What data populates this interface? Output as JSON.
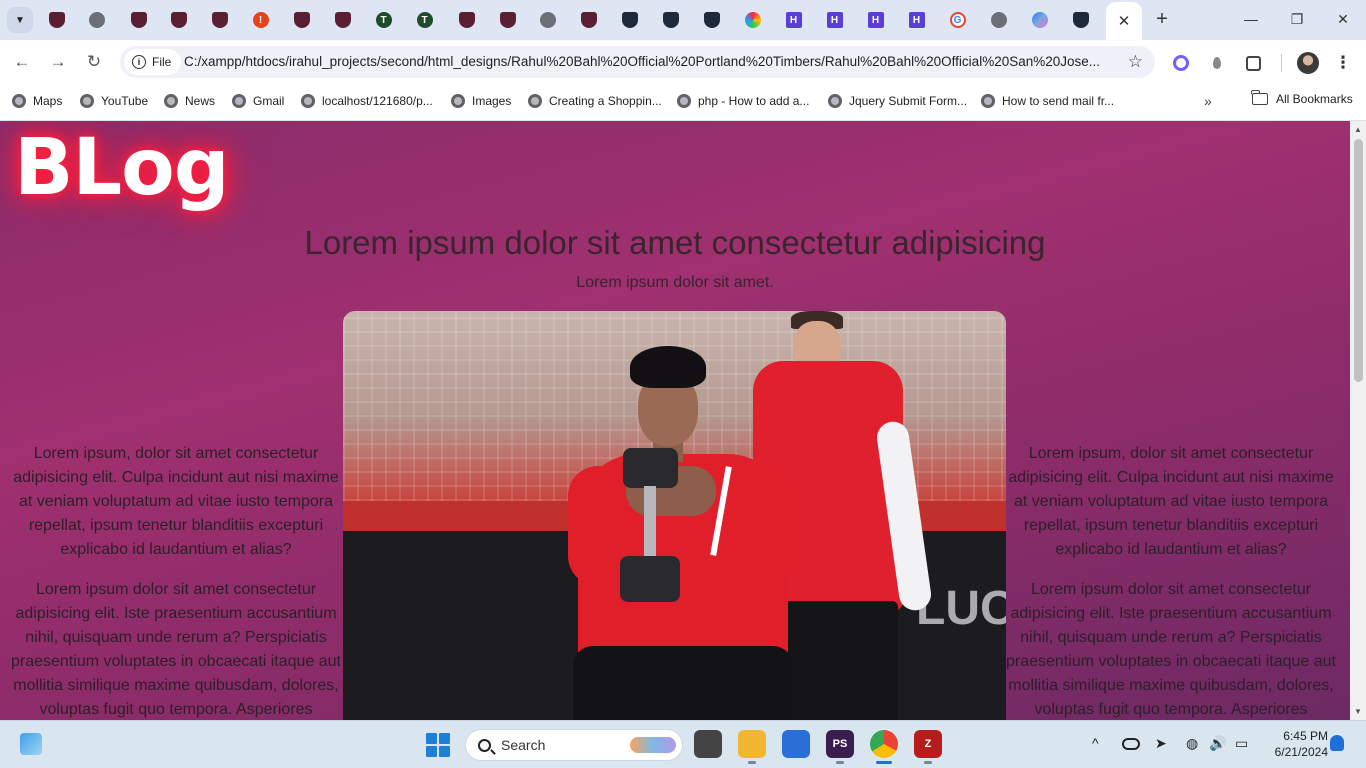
{
  "browser": {
    "tabs": [
      {
        "icon": "shield-crest-icon"
      },
      {
        "icon": "globe-icon"
      },
      {
        "icon": "shield-crest-icon"
      },
      {
        "icon": "shield-crest-icon"
      },
      {
        "icon": "shield-crest-icon"
      },
      {
        "icon": "alert-icon"
      },
      {
        "icon": "shield-crest-icon"
      },
      {
        "icon": "shield-crest-icon"
      },
      {
        "icon": "timbers-icon"
      },
      {
        "icon": "timbers-icon"
      },
      {
        "icon": "shield-crest-icon"
      },
      {
        "icon": "shield-crest-icon"
      },
      {
        "icon": "globe-icon"
      },
      {
        "icon": "shield-crest-icon"
      },
      {
        "icon": "sj-shield-icon"
      },
      {
        "icon": "sj-shield-icon"
      },
      {
        "icon": "sj-shield-icon"
      },
      {
        "icon": "ring-icon"
      },
      {
        "icon": "hh-icon"
      },
      {
        "icon": "hh-icon"
      },
      {
        "icon": "hh-icon"
      },
      {
        "icon": "hh-icon"
      },
      {
        "icon": "google-icon"
      },
      {
        "icon": "globe-icon"
      },
      {
        "icon": "copilot-icon"
      },
      {
        "icon": "sj-shield-icon"
      }
    ],
    "active_tab_close": "✕",
    "new_tab": "+",
    "window_controls": {
      "minimize": "—",
      "maximize": "❐",
      "close": "✕"
    },
    "toolbar": {
      "back": "←",
      "forward": "→",
      "reload": "↻",
      "site_chip": "File",
      "url": "C:/xampp/htdocs/irahul_projects/second/html_designs/Rahul%20Bahl%20Official%20Portland%20Timbers/Rahul%20Bahl%20Official%20San%20Jose...",
      "star": "☆",
      "menu": "⋮"
    },
    "bookmarks": [
      {
        "label": "Maps"
      },
      {
        "label": "YouTube"
      },
      {
        "label": "News"
      },
      {
        "label": "Gmail"
      },
      {
        "label": "localhost/121680/p..."
      },
      {
        "label": "Images"
      },
      {
        "label": "Creating a Shoppin..."
      },
      {
        "label": "php - How to add a..."
      },
      {
        "label": "Jquery Submit Form..."
      },
      {
        "label": "How to send mail fr..."
      }
    ],
    "bookmarks_overflow": "»",
    "all_bookmarks": "All Bookmarks"
  },
  "page": {
    "logo": "BLog",
    "headline": "Lorem ipsum dolor sit amet consectetur adipisicing",
    "subheadline": "Lorem ipsum dolor sit amet.",
    "left_paragraphs": [
      "Lorem ipsum, dolor sit amet consectetur adipisicing elit. Culpa incidunt aut nisi maxime at veniam voluptatum ad vitae iusto tempora repellat, ipsum tenetur blanditiis excepturi explicabo id laudantium et alias?",
      "Lorem ipsum dolor sit amet consectetur adipisicing elit. Iste praesentium accusantium nihil, quisquam unde rerum a? Perspiciatis praesentium voluptates in obcaecati itaque aut mollitia similique maxime quibusdam, dolores, voluptas fugit quo tempora. Asperiores"
    ],
    "right_paragraphs": [
      "Lorem ipsum, dolor sit amet consectetur adipisicing elit. Culpa incidunt aut nisi maxime at veniam voluptatum ad vitae iusto tempora repellat, ipsum tenetur blanditiis excepturi explicabo id laudantium et alias?",
      "Lorem ipsum dolor sit amet consectetur adipisicing elit. Iste praesentium accusantium nihil, quisquam unde rerum a? Perspiciatis praesentium voluptates in obcaecati itaque aut mollitia similique maxime quibusdam, dolores, voluptas fugit quo tempora. Asperiores"
    ],
    "hero_signage": "LUC",
    "colors": {
      "background": "#9a2f6e",
      "logo_glow": "#ff1e3c",
      "text": "#3a2430"
    }
  },
  "taskbar": {
    "search_placeholder": "Search",
    "apps": [
      {
        "name": "task-view"
      },
      {
        "name": "file-explorer"
      },
      {
        "name": "microsoft-store"
      },
      {
        "name": "phpstorm",
        "label": "PS"
      },
      {
        "name": "chrome"
      },
      {
        "name": "filezilla"
      }
    ],
    "tray": {
      "chevron": "^",
      "wifi": "◍",
      "volume": "🔊",
      "battery": "▭"
    },
    "time": "6:45 PM",
    "date": "6/21/2024"
  }
}
